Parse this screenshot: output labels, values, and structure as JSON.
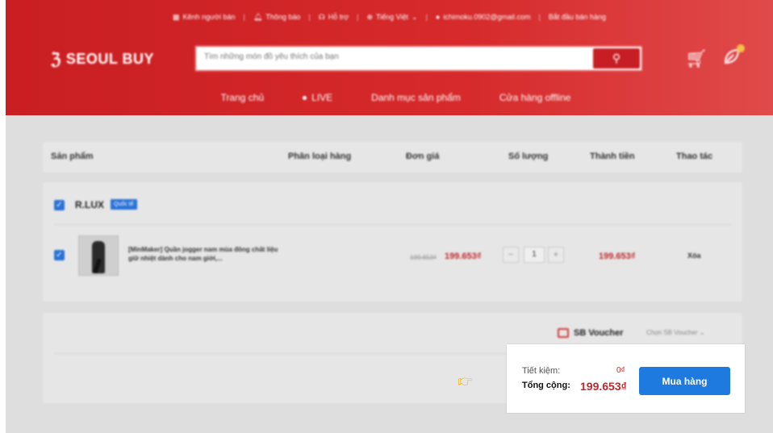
{
  "topbar": {
    "seller_channel": "Kênh người bán",
    "notifications": "Thông báo",
    "support": "Hỗ trợ",
    "language": "Tiếng Việt",
    "email": "ichimoku.0902@gmail.com",
    "start_selling": "Bắt đầu bán hàng"
  },
  "brand": {
    "name": "SEOUL BUY"
  },
  "search": {
    "placeholder": "Tìm những món đồ yêu thích của bạn"
  },
  "nav": {
    "home": "Trang chủ",
    "live": "LIVE",
    "categories": "Danh mục sản phẩm",
    "offline_stores": "Cửa hàng offline"
  },
  "table_header": {
    "product": "Sản phẩm",
    "variant": "Phân loại hàng",
    "unit_price": "Đơn giá",
    "quantity": "Số lượng",
    "subtotal": "Thành tiền",
    "actions": "Thao tác"
  },
  "shop": {
    "name": "R.LUX",
    "badge": "Quốc tế",
    "item": {
      "title": "[MinMaker] Quần jogger nam mùa đông chất liệu giữ nhiệt dành cho nam giới,...",
      "old_price": "199.653₫",
      "price": "199.653₫",
      "quantity": "1",
      "minus": "−",
      "plus": "+",
      "line_total": "199.653₫",
      "delete": "Xóa"
    }
  },
  "voucher": {
    "label": "SB Voucher",
    "select": "Chọn SB Voucher"
  },
  "summary": {
    "savings_label": "Tiết kiệm:",
    "savings_value": "0₫",
    "total_label": "Tổng cộng:",
    "total_value": "199.653₫",
    "buy_button": "Mua hàng"
  },
  "colors": {
    "brand_red": "#c91e22",
    "price_red": "#c0282c",
    "primary_blue": "#1f7ae0",
    "pointer_yellow": "#f0b81a"
  }
}
